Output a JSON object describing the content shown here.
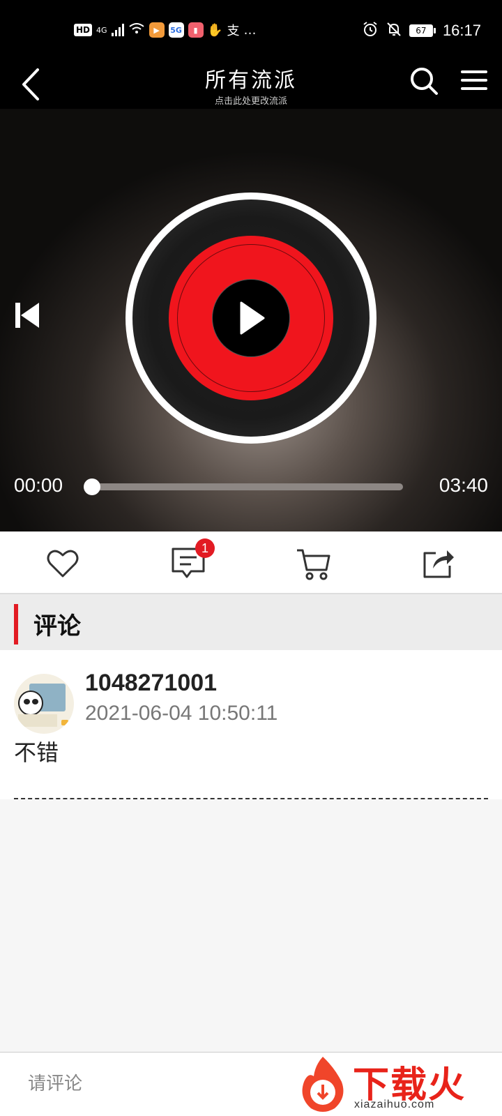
{
  "status_bar": {
    "left": [
      "HD",
      "4G",
      "5G",
      "支",
      "…"
    ],
    "battery": "67",
    "time": "16:17"
  },
  "header": {
    "title": "所有流派",
    "subtitle": "点击此处更改流派",
    "icons": [
      "back-icon",
      "search-icon",
      "menu-icon"
    ]
  },
  "player": {
    "elapsed": "00:00",
    "duration": "03:40",
    "progress": 0,
    "icons": [
      "previous-icon",
      "play-icon"
    ],
    "colors": {
      "disc_red": "#f0151d"
    }
  },
  "actions": {
    "icons": [
      "heart-icon",
      "comment-icon",
      "cart-icon",
      "share-icon"
    ],
    "comment_badge": "1"
  },
  "comments_section": {
    "title": "评论",
    "items": [
      {
        "user": "1048271001",
        "time": "2021-06-04 10:50:11",
        "text": "不错"
      }
    ]
  },
  "bottom": {
    "placeholder": "请评论",
    "watermark": "下载火",
    "watermark_url": "xiazaihuo.com"
  }
}
